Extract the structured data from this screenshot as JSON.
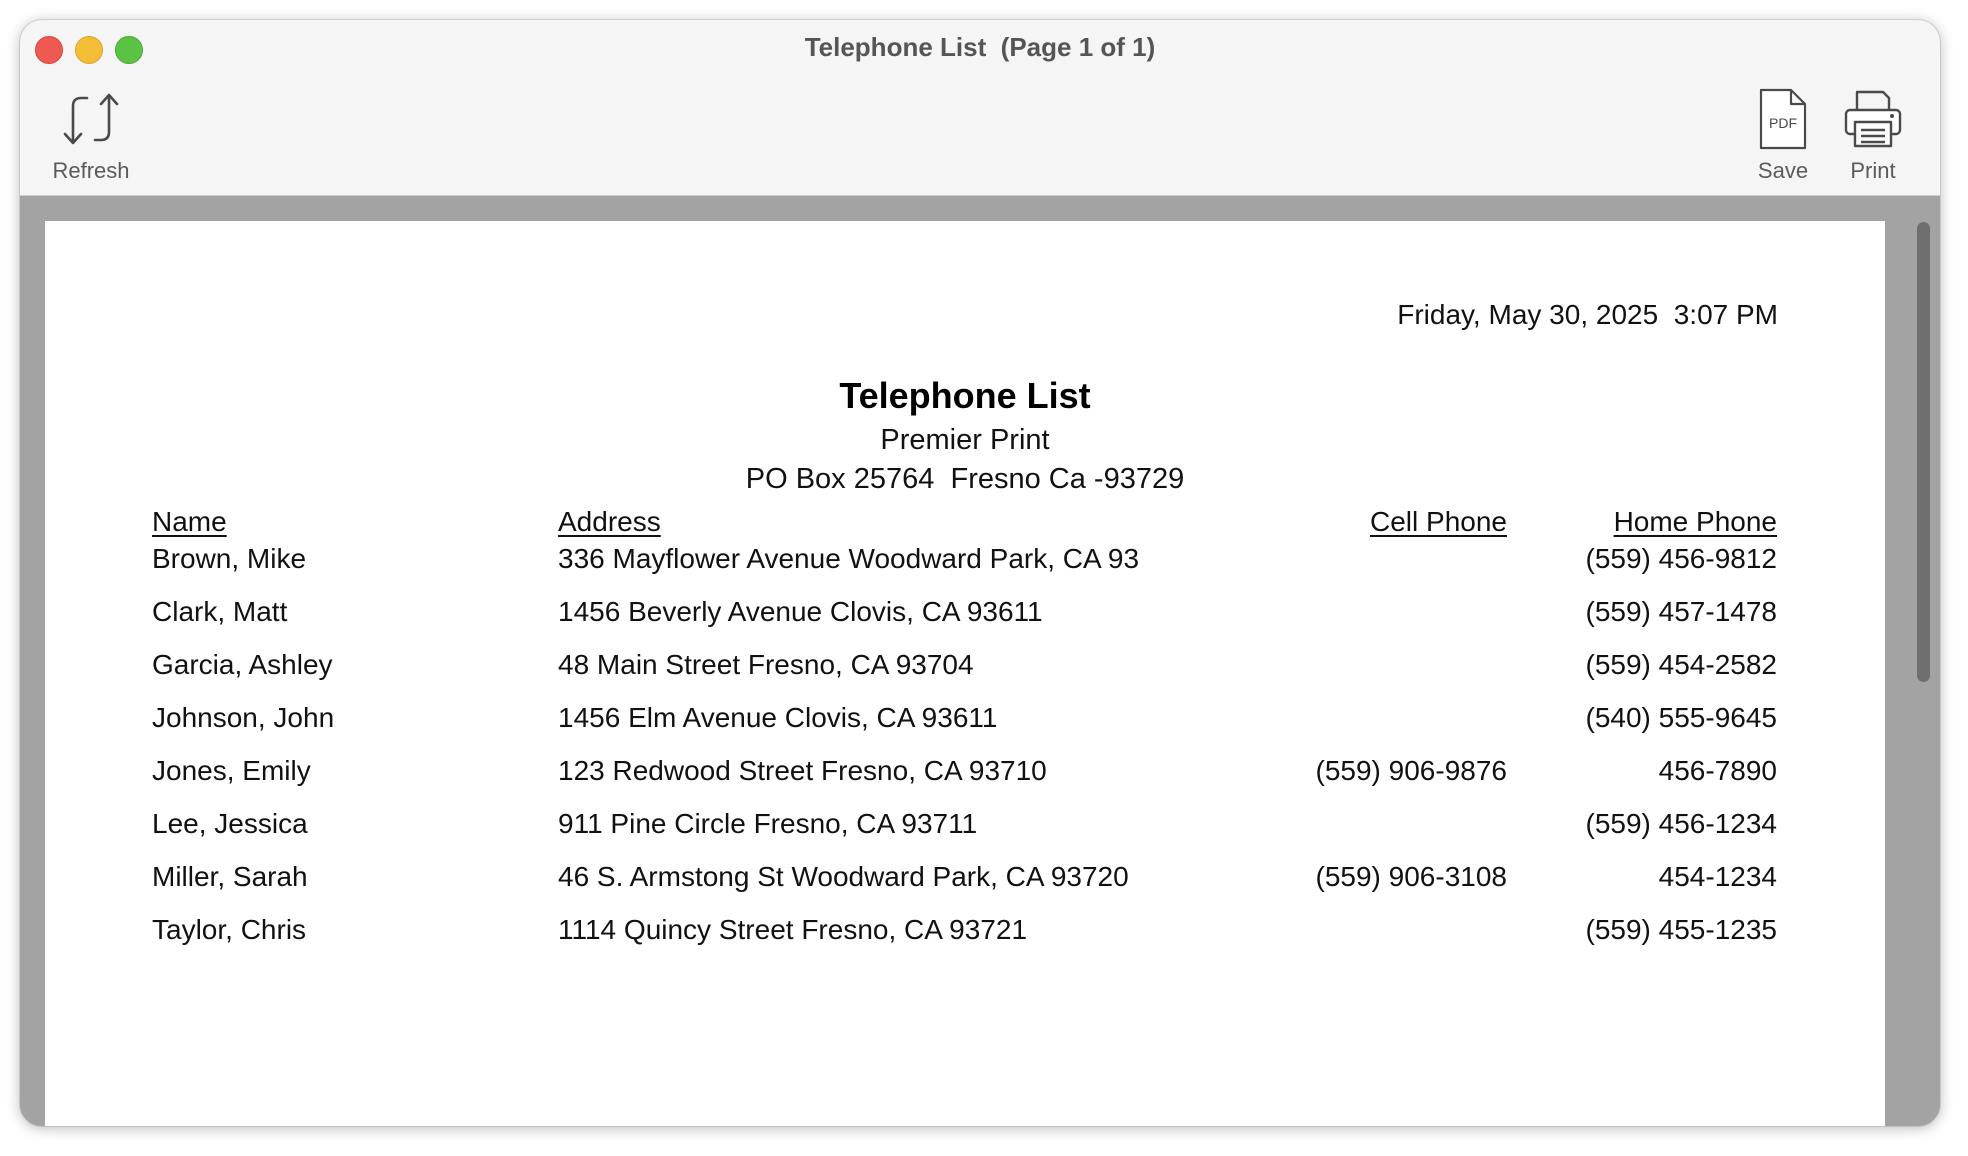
{
  "window": {
    "title": "Telephone List  (Page 1 of 1)"
  },
  "toolbar": {
    "refresh_label": "Refresh",
    "save_label": "Save",
    "print_label": "Print",
    "pdf_icon_text": "PDF"
  },
  "report": {
    "datetime": "Friday, May 30, 2025  3:07 PM",
    "title": "Telephone List",
    "company": "Premier Print",
    "address": "PO Box 25764  Fresno Ca -93729",
    "columns": {
      "name": "Name",
      "address": "Address",
      "cell_phone": "Cell Phone",
      "home_phone": "Home Phone"
    },
    "rows": [
      {
        "name": "Brown, Mike",
        "address": "336 Mayflower Avenue Woodward Park, CA 93",
        "cell": "",
        "home": "(559) 456-9812"
      },
      {
        "name": "Clark, Matt",
        "address": "1456 Beverly Avenue Clovis, CA 93611",
        "cell": "",
        "home": "(559) 457-1478"
      },
      {
        "name": "Garcia, Ashley",
        "address": "48 Main Street Fresno, CA 93704",
        "cell": "",
        "home": "(559) 454-2582"
      },
      {
        "name": "Johnson, John",
        "address": "1456 Elm Avenue Clovis, CA 93611",
        "cell": "",
        "home": "(540) 555-9645"
      },
      {
        "name": "Jones, Emily",
        "address": "123 Redwood Street Fresno, CA 93710",
        "cell": "(559) 906-9876",
        "home": "456-7890"
      },
      {
        "name": "Lee, Jessica",
        "address": "911 Pine Circle Fresno, CA 93711",
        "cell": "",
        "home": "(559) 456-1234"
      },
      {
        "name": "Miller, Sarah",
        "address": "46 S. Armstong St Woodward Park, CA 93720",
        "cell": "(559) 906-3108",
        "home": "454-1234"
      },
      {
        "name": "Taylor, Chris",
        "address": "1114 Quincy Street Fresno, CA 93721",
        "cell": "",
        "home": "(559) 455-1235"
      }
    ]
  }
}
